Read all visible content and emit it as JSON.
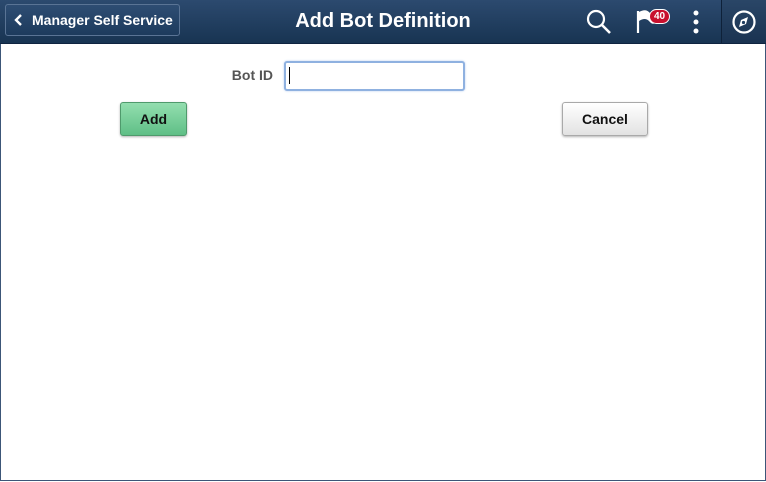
{
  "header": {
    "back_label": "Manager Self Service",
    "title": "Add Bot Definition",
    "notification_count": "40",
    "icons": [
      "chevron-left-icon",
      "search-icon",
      "flag-icon",
      "kebab-menu-icon",
      "navbar-compass-icon"
    ]
  },
  "form": {
    "bot_id_label": "Bot ID",
    "bot_id_value": ""
  },
  "buttons": {
    "add_label": "Add",
    "cancel_label": "Cancel"
  },
  "colors": {
    "header": "#1f3d60",
    "add_button": "#6fcb93",
    "badge": "#c8102e",
    "input_focus_border": "#8fb1e0"
  }
}
